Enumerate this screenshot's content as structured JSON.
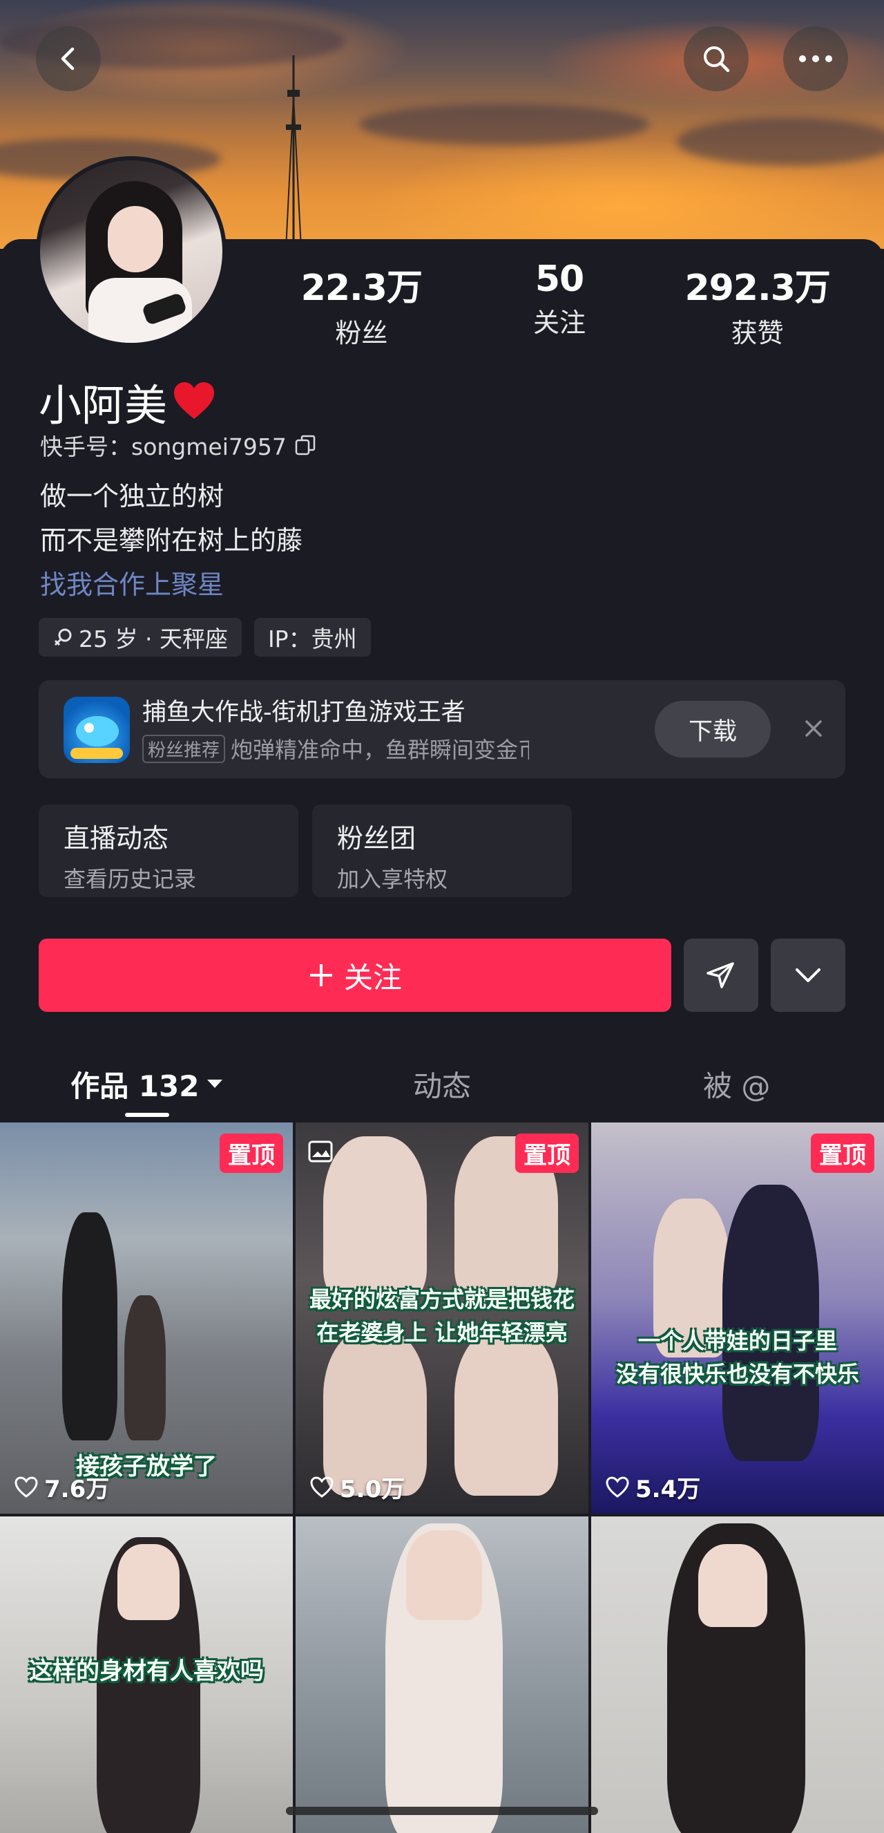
{
  "topbar": {
    "back": "back-icon",
    "search": "search-icon",
    "more": "more-icon"
  },
  "profile": {
    "name": "小阿美",
    "kuaishou_id": "快手号：songmei7957",
    "bio_lines": [
      "做一个独立的树",
      "而不是攀附在树上的藤"
    ],
    "bio_link": "找我合作上聚星",
    "tags": [
      "25 岁 · 天秤座",
      "IP：贵州"
    ]
  },
  "stats": [
    {
      "num": "22.3万",
      "label": "粉丝"
    },
    {
      "num": "50",
      "label": "关注"
    },
    {
      "num": "292.3万",
      "label": "获赞"
    }
  ],
  "ad": {
    "title": "捕鱼大作战-街机打鱼游戏王者",
    "badge": "粉丝推荐",
    "sub": "炮弹精准命中，鱼群瞬间变金币…",
    "button": "下载"
  },
  "quick_cards": [
    {
      "title": "直播动态",
      "sub": "查看历史记录"
    },
    {
      "title": "粉丝团",
      "sub": "加入享特权"
    }
  ],
  "actions": {
    "follow": "关注"
  },
  "tabs": [
    "作品 132",
    "动态",
    "被 @"
  ],
  "videos": [
    {
      "pinned": "置顶",
      "likes": "7.6万",
      "caption": "接孩子放学了"
    },
    {
      "pinned": "置顶",
      "likes": "5.0万",
      "caption": "最好的炫富方式就是把钱花\n在老婆身上 让她年轻漂亮"
    },
    {
      "pinned": "置顶",
      "likes": "5.4万",
      "caption": "一个人带娃的日子里\n没有很快乐也没有不快乐"
    },
    {
      "caption": "这样的身材有人喜欢吗"
    },
    {
      "caption": ""
    },
    {
      "caption": ""
    }
  ],
  "colors": {
    "accent": "#fe2c55",
    "link": "#6f86c4",
    "background": "#1b1b23"
  }
}
